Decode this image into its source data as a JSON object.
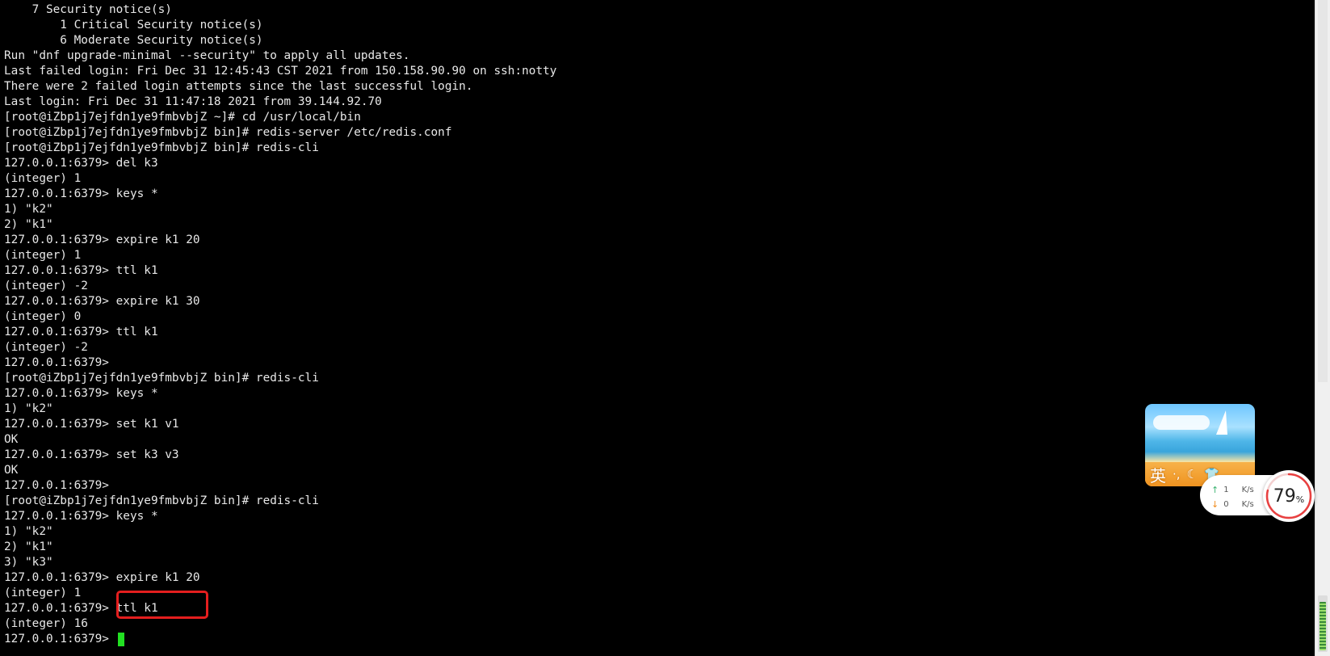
{
  "terminal": {
    "lines": [
      "    7 Security notice(s)",
      "        1 Critical Security notice(s)",
      "        6 Moderate Security notice(s)",
      "Run \"dnf upgrade-minimal --security\" to apply all updates.",
      "Last failed login: Fri Dec 31 12:45:43 CST 2021 from 150.158.90.90 on ssh:notty",
      "There were 2 failed login attempts since the last successful login.",
      "Last login: Fri Dec 31 11:47:18 2021 from 39.144.92.70",
      "[root@iZbp1j7ejfdn1ye9fmbvbjZ ~]# cd /usr/local/bin",
      "[root@iZbp1j7ejfdn1ye9fmbvbjZ bin]# redis-server /etc/redis.conf",
      "[root@iZbp1j7ejfdn1ye9fmbvbjZ bin]# redis-cli",
      "127.0.0.1:6379> del k3",
      "(integer) 1",
      "127.0.0.1:6379> keys *",
      "1) \"k2\"",
      "2) \"k1\"",
      "127.0.0.1:6379> expire k1 20",
      "(integer) 1",
      "127.0.0.1:6379> ttl k1",
      "(integer) -2",
      "127.0.0.1:6379> expire k1 30",
      "(integer) 0",
      "127.0.0.1:6379> ttl k1",
      "(integer) -2",
      "127.0.0.1:6379>",
      "[root@iZbp1j7ejfdn1ye9fmbvbjZ bin]# redis-cli",
      "127.0.0.1:6379> keys *",
      "1) \"k2\"",
      "127.0.0.1:6379> set k1 v1",
      "OK",
      "127.0.0.1:6379> set k3 v3",
      "OK",
      "127.0.0.1:6379>",
      "[root@iZbp1j7ejfdn1ye9fmbvbjZ bin]# redis-cli",
      "127.0.0.1:6379> keys *",
      "1) \"k2\"",
      "2) \"k1\"",
      "3) \"k3\"",
      "127.0.0.1:6379> expire k1 20",
      "(integer) 1",
      "127.0.0.1:6379> ttl k1",
      "(integer) 16"
    ],
    "prompt": "127.0.0.1:6379> ",
    "cursor_color": "#22e022",
    "highlight_color": "#e41e1e"
  },
  "ime_widget": {
    "lang_label": "英",
    "icons": [
      "punctuation-icon",
      "moon-icon",
      "shirt-icon"
    ]
  },
  "net_widget": {
    "upload_value": "1",
    "upload_unit": "K/s",
    "download_value": "0",
    "download_unit": "K/s",
    "usage_value": "79",
    "usage_unit": "%",
    "usage_fraction": 0.79,
    "gauge_color": "#e84040"
  }
}
